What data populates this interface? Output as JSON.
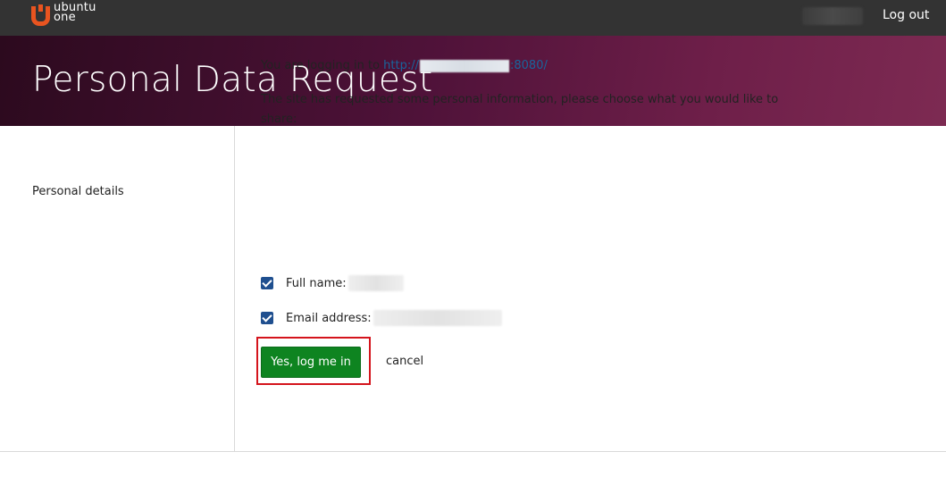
{
  "topbar": {
    "logo_line1": "ubuntu",
    "logo_line2": "one",
    "logout_label": "Log out",
    "accent_color": "#e95420"
  },
  "hero": {
    "title": "Personal Data Request"
  },
  "sidebar": {
    "label": "Personal details"
  },
  "content": {
    "login_prefix": "You are logging in to ",
    "url_start": "http://",
    "url_end": ":8080/",
    "request_text": "The site has requested some personal information, please choose what you would like to share:",
    "options": [
      {
        "label": "Full name:",
        "checked": true
      },
      {
        "label": "Email address:",
        "checked": true
      }
    ],
    "confirm_label": "Yes, log me in",
    "cancel_label": "cancel",
    "confirm_color": "#0e8420"
  }
}
